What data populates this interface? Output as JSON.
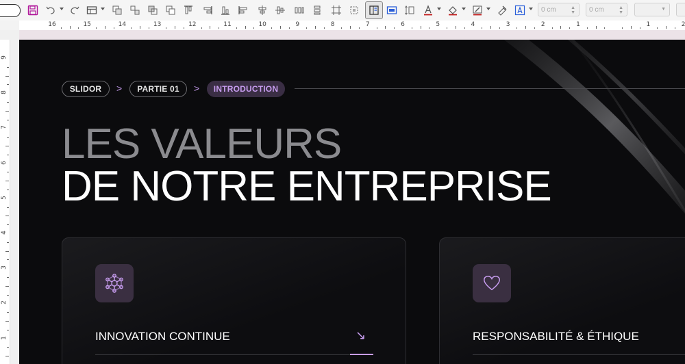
{
  "toolbar": {
    "width_field": "0 cm",
    "height_field": "0 cm",
    "icons": [
      "save-icon",
      "undo-icon",
      "redo-icon",
      "table-icon",
      "group-icon",
      "ungroup-icon",
      "bring-front-icon",
      "send-back-icon",
      "align-top-icon",
      "align-right-icon",
      "align-bottom-icon",
      "align-left-icon",
      "align-center-h-icon",
      "align-center-v-icon",
      "distribute-icon",
      "crop-icon",
      "select-icon",
      "textbox-icon",
      "frame-icon",
      "line-height-icon",
      "font-color-icon",
      "fill-color-icon",
      "border-icon",
      "format-paint-icon",
      "text-style-icon"
    ]
  },
  "ruler": {
    "horizontal": [
      "16",
      "15",
      "14",
      "13",
      "12",
      "11",
      "10",
      "9",
      "8",
      "7",
      "6",
      "5",
      "4",
      "3",
      "2",
      "1",
      "",
      "1",
      "2"
    ],
    "vertical": [
      "9",
      "8",
      "7",
      "6",
      "5",
      "4",
      "3",
      "2",
      "1"
    ]
  },
  "slide": {
    "breadcrumbs": [
      "SLIDOR",
      "PARTIE 01",
      "INTRODUCTION"
    ],
    "breadcrumb_separator": ">",
    "title_line1": "LES VALEURS",
    "title_line2": "DE NOTRE ENTREPRISE",
    "cards": [
      {
        "title": "INNOVATION CONTINUE",
        "icon": "network-icon",
        "arrow": "↘"
      },
      {
        "title": "RESPONSABILITÉ & ÉTHIQUE",
        "icon": "heart-icon",
        "arrow": ""
      }
    ],
    "colors": {
      "background": "#0b0b0d",
      "accent": "#c89df0",
      "title_gray": "#8b8b8f",
      "card_icon_bg": "#3a2f41"
    }
  }
}
